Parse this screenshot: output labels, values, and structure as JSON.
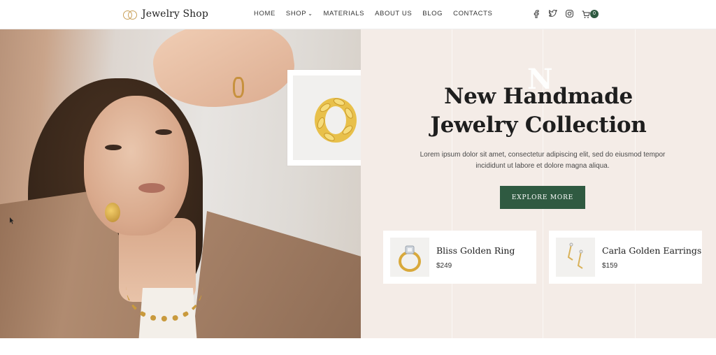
{
  "header": {
    "logo_text": "Jewelry Shop",
    "nav": [
      {
        "label": "HOME"
      },
      {
        "label": "SHOP"
      },
      {
        "label": "MATERIALS"
      },
      {
        "label": "ABOUT US"
      },
      {
        "label": "BLOG"
      },
      {
        "label": "CONTACTS"
      }
    ],
    "social_icons": [
      "facebook-icon",
      "twitter-icon",
      "instagram-icon"
    ],
    "cart_count": "0"
  },
  "hero": {
    "deco_letter": "N",
    "title_line1": "New Handmade",
    "title_line2": "Jewelry Collection",
    "text": "Lorem ipsum dolor sit amet, consectetur adipiscing elit, sed do eiusmod tempor incididunt ut labore et dolore magna aliqua.",
    "button_label": "EXPLORE MORE"
  },
  "products": [
    {
      "name": "Bliss Golden Ring",
      "price": "$249"
    },
    {
      "name": "Carla Golden Earrings",
      "price": "$159"
    }
  ],
  "colors": {
    "accent_green": "#2f5a41",
    "hero_bg": "#f4ece7",
    "gold": "#c9a15a"
  }
}
